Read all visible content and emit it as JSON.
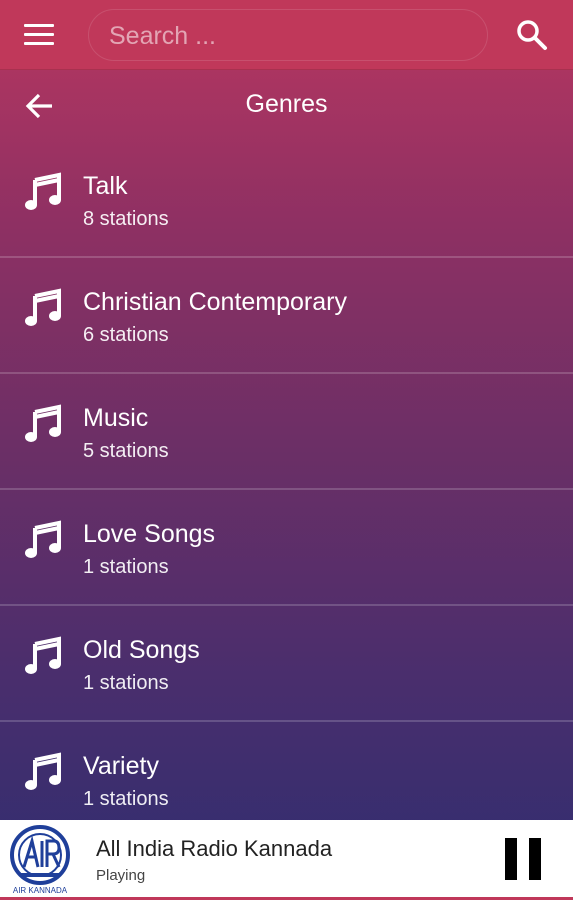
{
  "topbar": {
    "search_placeholder": "Search ..."
  },
  "header": {
    "title": "Genres"
  },
  "genres": [
    {
      "name": "Talk",
      "count": "8 stations"
    },
    {
      "name": "Christian Contemporary",
      "count": "6 stations"
    },
    {
      "name": "Music",
      "count": "5 stations"
    },
    {
      "name": "Love Songs",
      "count": "1 stations"
    },
    {
      "name": "Old Songs",
      "count": "1 stations"
    },
    {
      "name": "Variety",
      "count": "1 stations"
    }
  ],
  "player": {
    "station": "All India Radio Kannada",
    "status": "Playing",
    "logo_text": "AIR KANNADA"
  },
  "icons": {
    "menu": "menu-icon",
    "search": "search-icon",
    "back": "arrow-back-icon",
    "genre": "music-note-icon",
    "pause": "pause-icon"
  },
  "colors": {
    "topbar": "#c0385a",
    "gradient_top": "#b83760",
    "gradient_bottom": "#2f2d70",
    "logo_blue": "#1f3f9a"
  }
}
